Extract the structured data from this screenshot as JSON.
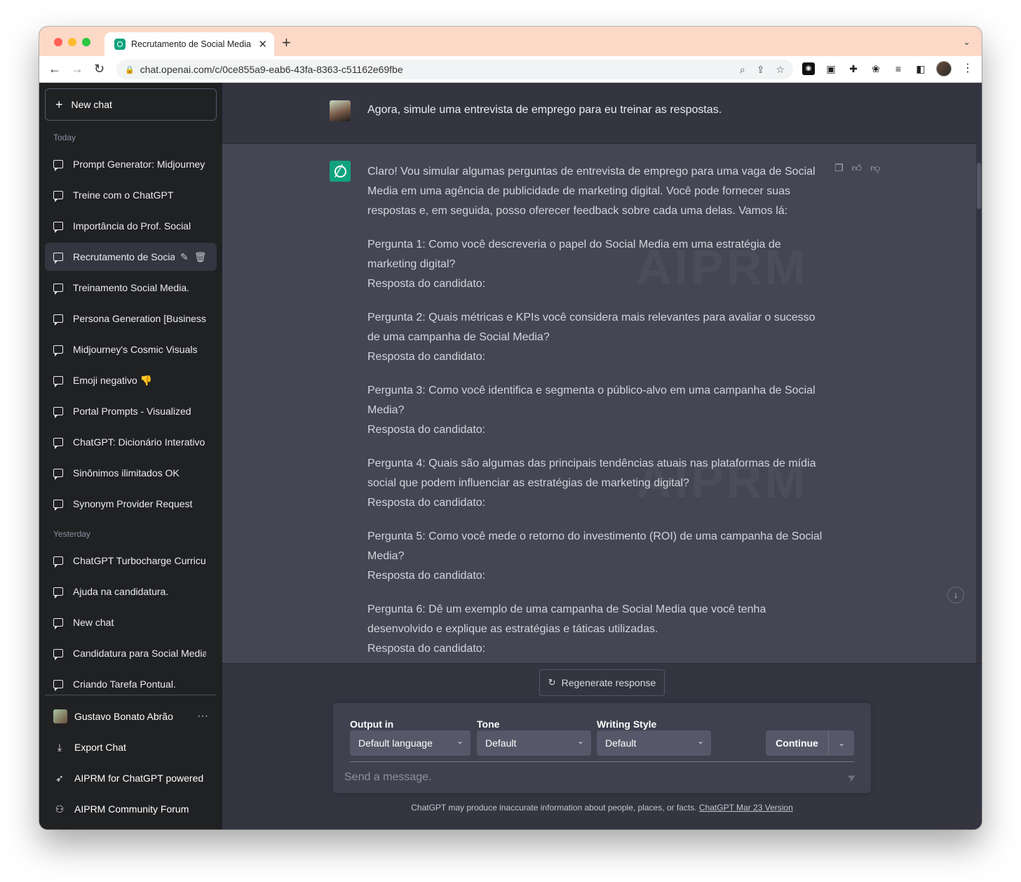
{
  "browser": {
    "tab_title": "Recrutamento de Social Media",
    "tab_close": "✕",
    "new_tab": "+",
    "url": "chat.openai.com/c/0ce855a9-eab6-43fa-8363-c51162e69fbe"
  },
  "sidebar": {
    "new_chat_label": "New chat",
    "today_label": "Today",
    "today_items": [
      "Prompt Generator: Midjourney",
      "Treine com o ChatGPT",
      "Importância do Prof. Social",
      "Recrutamento de Social Media",
      "Treinamento Social Media.",
      "Persona Generation [Business]",
      "Midjourney's Cosmic Visuals",
      "Emoji negativo 👎",
      "Portal Prompts - Visualized",
      "ChatGPT: Dicionário Interativo",
      "Sinônimos ilimitados OK",
      "Synonym Provider Request"
    ],
    "yesterday_label": "Yesterday",
    "yesterday_items": [
      "ChatGPT Turbocharge Curriculum",
      "Ajuda na candidatura.",
      "New chat",
      "Candidatura para Social Media",
      "Criando Tarefa Pontual."
    ],
    "user_name": "Gustavo Bonato Abrão",
    "export_chat": "Export Chat",
    "aiprm_powered": "AIPRM for ChatGPT powered",
    "aiprm_forum": "AIPRM Community Forum"
  },
  "conversation": {
    "user_message": "Agora, simule uma entrevista de emprego para eu treinar as respostas.",
    "assistant_intro": "Claro! Vou simular algumas perguntas de entrevista de emprego para uma vaga de Social Media em uma agência de publicidade de marketing digital. Você pode fornecer suas respostas e, em seguida, posso oferecer feedback sobre cada uma delas. Vamos lá:",
    "questions": [
      "Pergunta 1: Como você descreveria o papel do Social Media em uma estratégia de marketing digital?",
      "Pergunta 2: Quais métricas e KPIs você considera mais relevantes para avaliar o sucesso de uma campanha de Social Media?",
      "Pergunta 3: Como você identifica e segmenta o público-alvo em uma campanha de Social Media?",
      "Pergunta 4: Quais são algumas das principais tendências atuais nas plataformas de mídia social que podem influenciar as estratégias de marketing digital?",
      "Pergunta 5: Como você mede o retorno do investimento (ROI) de uma campanha de Social Media?",
      "Pergunta 6: Dê um exemplo de uma campanha de Social Media que você tenha desenvolvido e explique as estratégias e táticas utilizadas."
    ],
    "answer_label": "Resposta do candidato:",
    "watermark": "AIPRM"
  },
  "composer": {
    "regenerate_label": "Regenerate response",
    "output_label": "Output in",
    "output_value": "Default language",
    "tone_label": "Tone",
    "tone_value": "Default",
    "style_label": "Writing Style",
    "style_value": "Default",
    "continue_label": "Continue",
    "placeholder": "Send a message."
  },
  "footer": {
    "disclaimer": "ChatGPT may produce inaccurate information about people, places, or facts.",
    "version_link": "ChatGPT Mar 23 Version"
  },
  "colors": {
    "sidebar_bg": "#202123",
    "main_bg": "#343541",
    "assistant_bg": "#444654",
    "accent": "#10a37f",
    "tabstrip_bg": "#fcd9c7"
  },
  "icons": {
    "back": "arrow-left-icon",
    "forward": "arrow-right-icon",
    "reload": "reload-icon",
    "lock": "lock-icon",
    "search": "search-icon",
    "share": "share-icon",
    "bookmark": "star-icon",
    "chat": "chat-bubble-icon",
    "edit": "pencil-icon",
    "delete": "trash-icon",
    "copy": "clipboard-icon",
    "thumbs_up": "thumbs-up-icon",
    "thumbs_down": "thumbs-down-icon",
    "scroll_down": "arrow-down-icon",
    "regenerate": "refresh-icon",
    "send": "paper-plane-icon"
  }
}
